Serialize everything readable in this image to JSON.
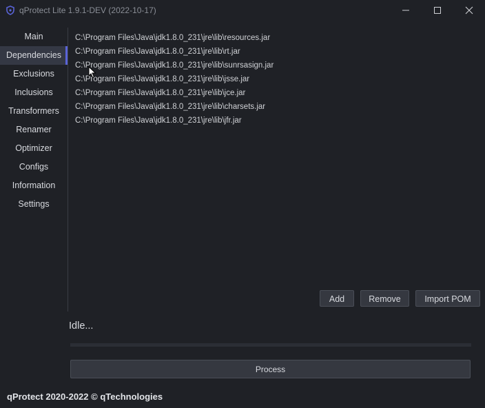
{
  "window": {
    "title": "qProtect Lite 1.9.1-DEV (2022-10-17)",
    "icon": "shield-icon",
    "controls": [
      "minimize-icon",
      "maximize-icon",
      "close-icon"
    ]
  },
  "sidebar": {
    "items": [
      {
        "label": "Main"
      },
      {
        "label": "Dependencies",
        "active": true
      },
      {
        "label": "Exclusions"
      },
      {
        "label": "Inclusions"
      },
      {
        "label": "Transformers"
      },
      {
        "label": "Renamer"
      },
      {
        "label": "Optimizer"
      },
      {
        "label": "Configs"
      },
      {
        "label": "Information"
      },
      {
        "label": "Settings"
      }
    ]
  },
  "dependencies": {
    "items": [
      "C:\\Program Files\\Java\\jdk1.8.0_231\\jre\\lib\\resources.jar",
      "C:\\Program Files\\Java\\jdk1.8.0_231\\jre\\lib\\rt.jar",
      "C:\\Program Files\\Java\\jdk1.8.0_231\\jre\\lib\\sunrsasign.jar",
      "C:\\Program Files\\Java\\jdk1.8.0_231\\jre\\lib\\jsse.jar",
      "C:\\Program Files\\Java\\jdk1.8.0_231\\jre\\lib\\jce.jar",
      "C:\\Program Files\\Java\\jdk1.8.0_231\\jre\\lib\\charsets.jar",
      "C:\\Program Files\\Java\\jdk1.8.0_231\\jre\\lib\\jfr.jar"
    ],
    "buttons": {
      "add": "Add",
      "remove": "Remove",
      "import_pom": "Import POM"
    }
  },
  "status": {
    "text": "Idle...",
    "progress": 0
  },
  "process_label": "Process",
  "footer": "qProtect 2020-2022 © qTechnologies",
  "colors": {
    "background": "#1f2126",
    "accent": "#5a64d8",
    "button": "#353840",
    "active_nav": "#343844",
    "text": "#d6d8dc"
  }
}
